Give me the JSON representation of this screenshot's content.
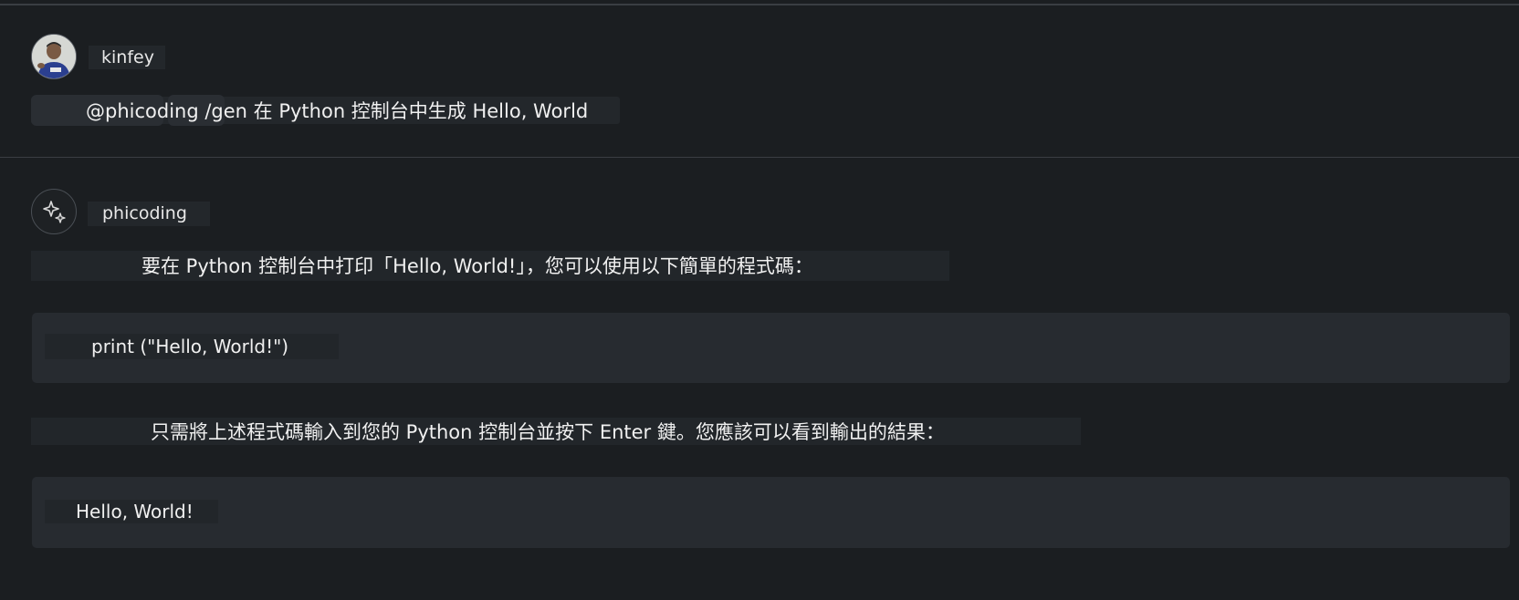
{
  "user": {
    "name": "kinfey",
    "avatar_icon": "user-photo-avatar",
    "query": "@phicoding /gen 在 Python 控制台中生成 Hello, World"
  },
  "assistant": {
    "name": "phicoding",
    "avatar_icon": "sparkle-icon",
    "intro": "要在 Python 控制台中打印「Hello, World!」，您可以使用以下簡單的程式碼：",
    "code": "print (\"Hello, World!\")",
    "instruction": "只需將上述程式碼輸入到您的 Python 控制台並按下 Enter 鍵。您應該可以看到輸出的結果：",
    "output": "Hello, World!"
  },
  "colors": {
    "background": "#1b1e21",
    "code_background": "#272b30",
    "text": "#f0f0f0"
  }
}
